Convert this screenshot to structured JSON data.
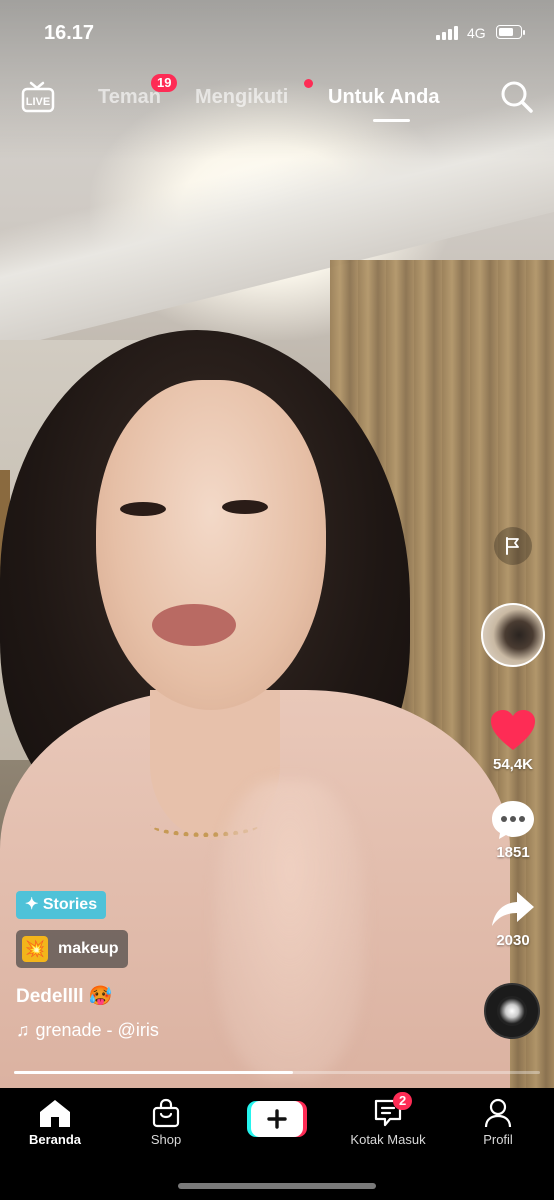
{
  "status_bar": {
    "time": "16.17",
    "network": "4G",
    "battery_level": 0.75
  },
  "top_nav": {
    "live_label": "LIVE",
    "tabs": [
      {
        "label": "Teman",
        "badge": "19"
      },
      {
        "label": "Mengikuti",
        "has_dot": true
      },
      {
        "label": "Untuk Anda",
        "active": true
      }
    ],
    "search_icon": "search-icon"
  },
  "right_rail": {
    "likes": "54,4K",
    "comments": "1851",
    "shares": "2030",
    "icons": [
      "flag-icon",
      "creator-avatar",
      "heart-icon",
      "comment-icon",
      "share-icon",
      "music-disc-icon"
    ]
  },
  "video_info": {
    "stories_label": "Stories",
    "topic_label": "makeup",
    "username": "Dedellll",
    "username_emoji": "🥵",
    "music": "grenade - @iris"
  },
  "playback_progress": 0.53,
  "bottom_nav": {
    "items": [
      {
        "label": "Beranda",
        "icon": "home-icon",
        "active": true
      },
      {
        "label": "Shop",
        "icon": "shop-bag-icon"
      },
      {
        "label": "",
        "icon": "create-plus-icon"
      },
      {
        "label": "Kotak Masuk",
        "icon": "inbox-icon",
        "badge": "2"
      },
      {
        "label": "Profil",
        "icon": "profile-icon"
      }
    ]
  },
  "colors": {
    "accent": "#fe2c55",
    "cyan": "#25f4ee",
    "stories": "#4fc2d8",
    "like": "#fe2c55"
  }
}
